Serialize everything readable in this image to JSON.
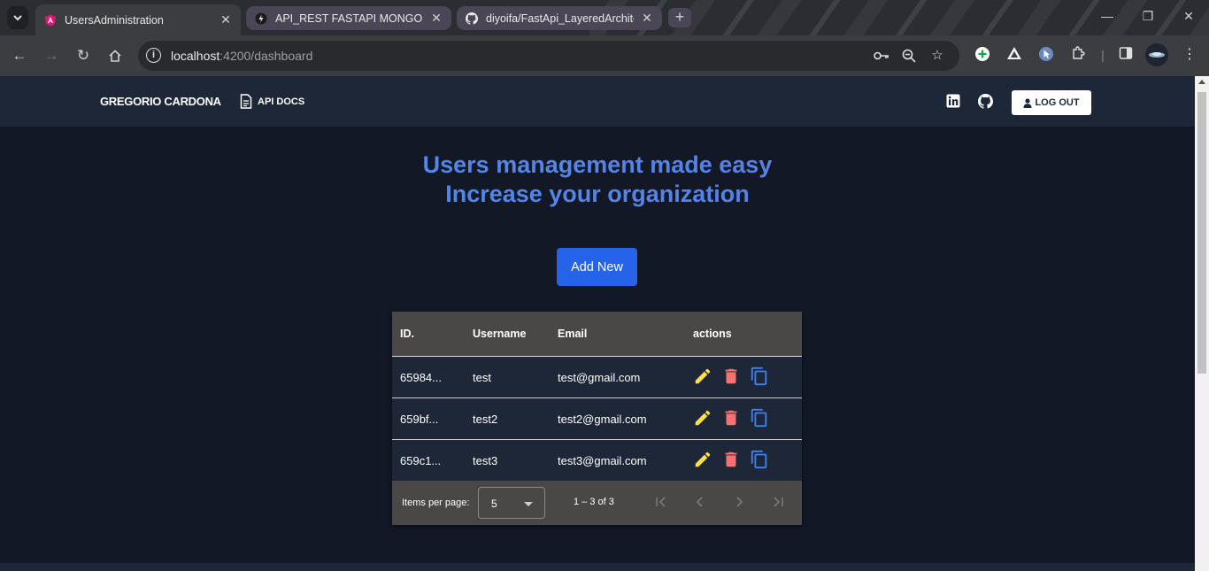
{
  "browser": {
    "tabs": [
      {
        "title": "UsersAdministration",
        "active": true,
        "favicon": "angular-icon"
      },
      {
        "title": "API_REST FASTAPI MONGODB",
        "active": false,
        "favicon": "fastapi-icon"
      },
      {
        "title": "diyoifa/FastApi_LayeredArchitec",
        "active": false,
        "favicon": "github-icon"
      }
    ],
    "new_tab": "+",
    "url_host": "localhost",
    "url_rest": ":4200/dashboard"
  },
  "header": {
    "brand": "GREGORIO CARDONA",
    "api_docs": "API DOCS",
    "logout": "LOG OUT"
  },
  "hero": {
    "line1": "Users management made easy",
    "line2": "Increase your organization"
  },
  "add_button": "Add New",
  "table": {
    "columns": [
      "ID.",
      "Username",
      "Email",
      "actions"
    ],
    "rows": [
      {
        "id": "65984...",
        "username": "test",
        "email": "test@gmail.com"
      },
      {
        "id": "659bf...",
        "username": "test2",
        "email": "test2@gmail.com"
      },
      {
        "id": "659c1...",
        "username": "test3",
        "email": "test3@gmail.com"
      }
    ],
    "colors": {
      "edit": "#fde047",
      "delete": "#f87171",
      "copy": "#3b82f6"
    }
  },
  "paginator": {
    "items_per_page_label": "Items per page:",
    "page_size": "5",
    "range": "1 – 3 of 3"
  }
}
